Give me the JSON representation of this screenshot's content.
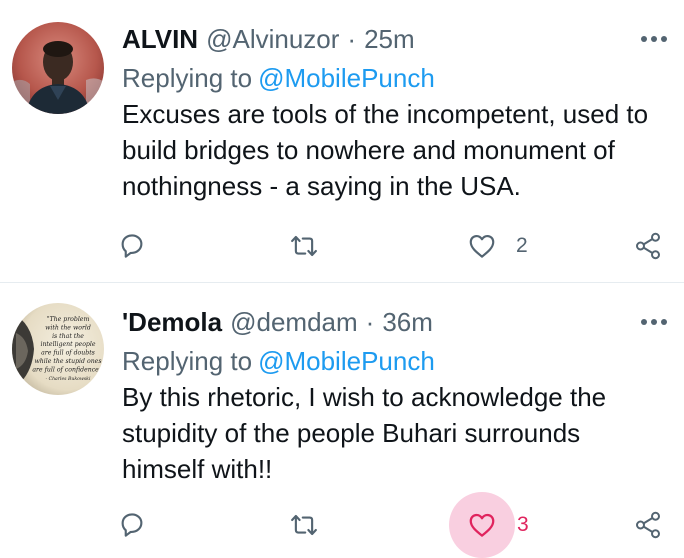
{
  "tweets": [
    {
      "display_name": "ALVIN",
      "handle": "@Alvinuzor",
      "separator": "·",
      "time": "25m",
      "replying_prefix": "Replying to",
      "replying_to": "@MobilePunch",
      "text": "Excuses are tools of the incompetent, used to build bridges to nowhere and monument of nothingness - a saying in the USA.",
      "like_count": "2",
      "liked": false,
      "avatar": "profile-photo-man"
    },
    {
      "display_name": "'Demola",
      "handle": "@demdam",
      "separator": "·",
      "time": "36m",
      "replying_prefix": "Replying to",
      "replying_to": "@MobilePunch",
      "text": "By this rhetoric, I wish to acknowledge the stupidity of the people Buhari surrounds himself with!!",
      "like_count": "3",
      "liked": true,
      "avatar": "quote-image-avatar",
      "avatar_quote": [
        "\"The problem",
        "with the world",
        "is that the",
        "intelligent people",
        "are full of doubts",
        "while the stupid ones",
        "are full of confidence.\"",
        "- Charles Bukowski"
      ]
    }
  ],
  "icons": {
    "more": "more-dots-icon",
    "reply": "reply-icon",
    "retweet": "retweet-icon",
    "like": "heart-icon",
    "share": "share-icon"
  },
  "colors": {
    "primary_text": "#0f1419",
    "secondary_text": "#536471",
    "link": "#1d9bf0",
    "like_active": "#e0245e",
    "like_highlight": "#f9cfe0",
    "divider": "#e6ecf0"
  }
}
